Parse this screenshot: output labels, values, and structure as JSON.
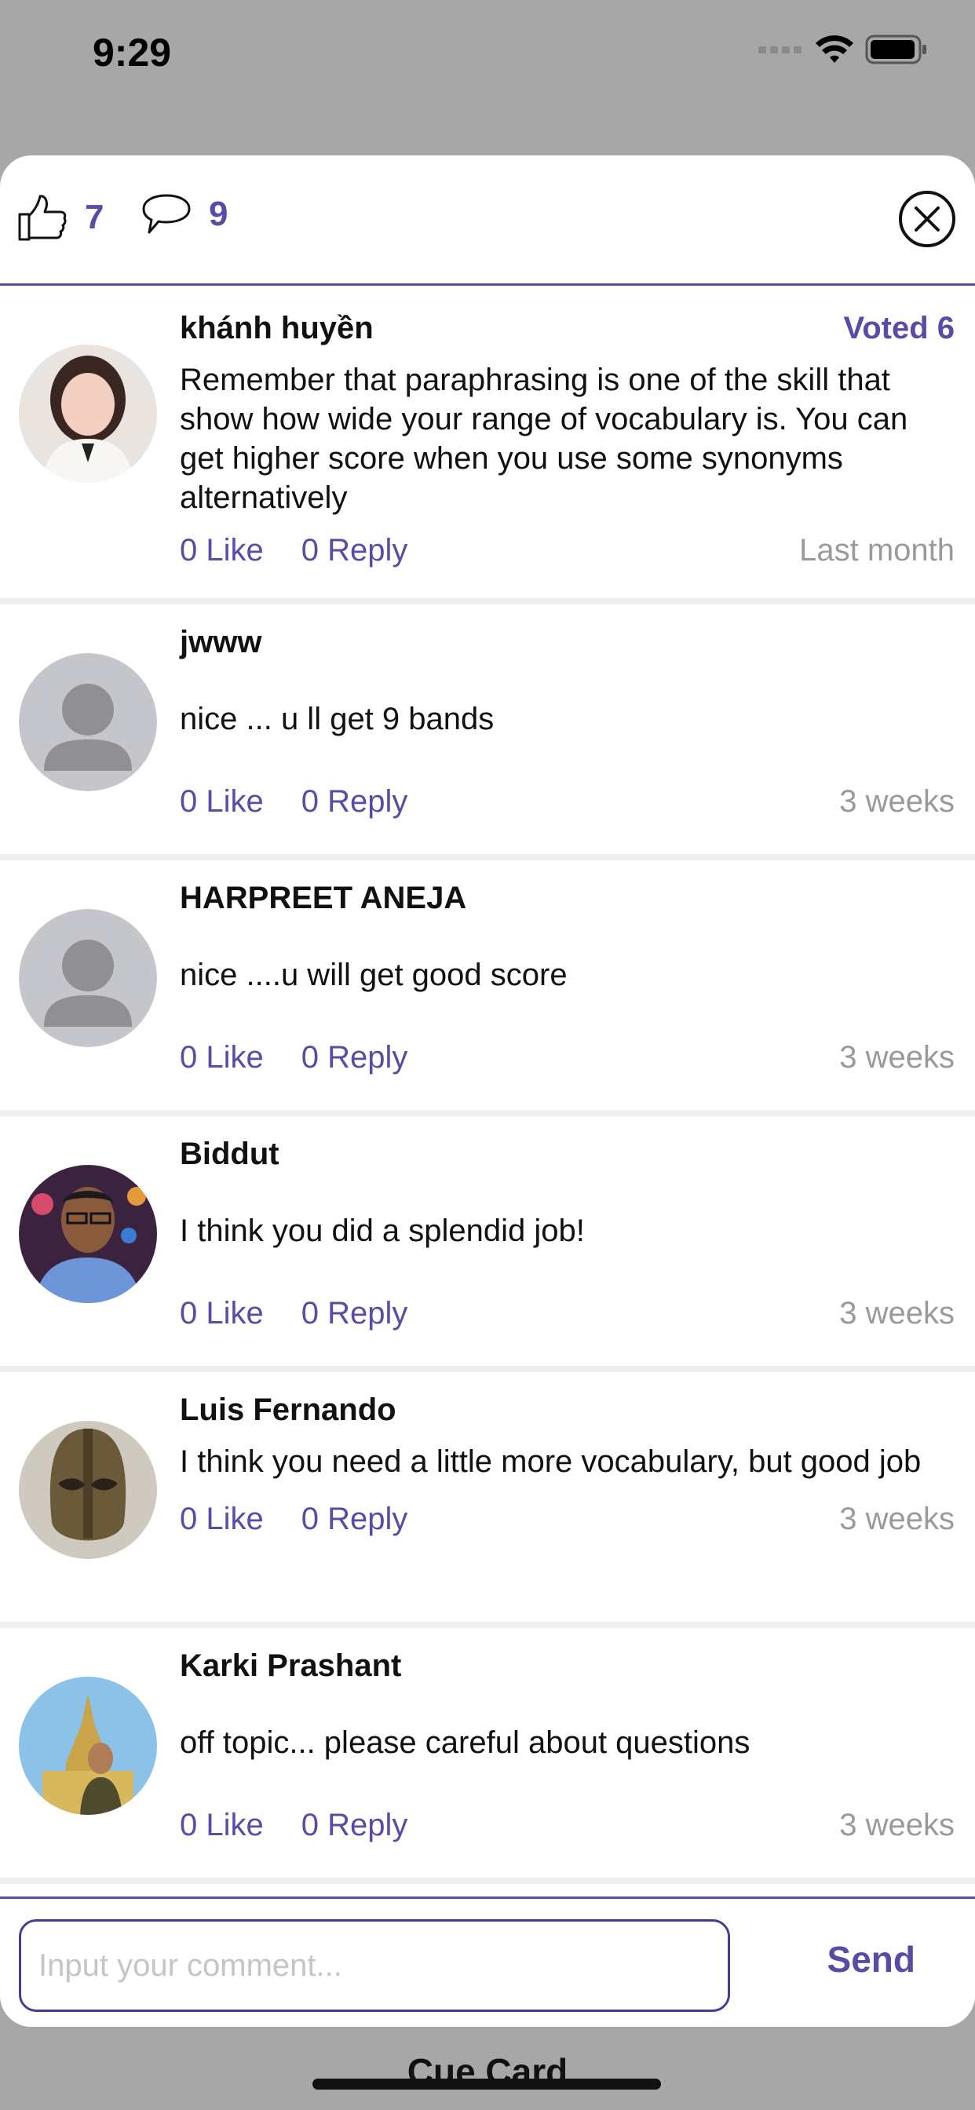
{
  "status_bar": {
    "time": "9:29"
  },
  "header": {
    "likes_count": "7",
    "comments_count": "9"
  },
  "comments": [
    {
      "author": "khánh huyền",
      "voted": "Voted 6",
      "text": "Remember that paraphrasing is one of the skill that show how wide your range of vocabulary is. You can get higher score when you use some synonyms alternatively",
      "like_label": "0 Like",
      "reply_label": "0 Reply",
      "time": "Last month",
      "avatar": "photo"
    },
    {
      "author": "jwww",
      "text": "nice ... u ll get 9 bands",
      "like_label": "0 Like",
      "reply_label": "0 Reply",
      "time": "3 weeks",
      "avatar": "default"
    },
    {
      "author": "HARPREET ANEJA",
      "text": "nice ....u will get good score",
      "like_label": "0 Like",
      "reply_label": "0 Reply",
      "time": "3 weeks",
      "avatar": "default"
    },
    {
      "author": "Biddut",
      "text": "I think you did a splendid job!",
      "like_label": "0 Like",
      "reply_label": "0 Reply",
      "time": "3 weeks",
      "avatar": "photo"
    },
    {
      "author": "Luis Fernando",
      "text": "I think you need a little more vocabulary, but good job",
      "like_label": "0 Like",
      "reply_label": "0 Reply",
      "time": "3 weeks",
      "avatar": "photo"
    },
    {
      "author": "Karki Prashant",
      "text": "off topic... please careful about questions",
      "like_label": "0 Like",
      "reply_label": "0 Reply",
      "time": "3 weeks",
      "avatar": "photo"
    }
  ],
  "footer": {
    "input_placeholder": "Input your comment...",
    "send_label": "Send"
  },
  "background": {
    "title": "Cue Card"
  },
  "colors": {
    "accent": "#5b4aa6",
    "muted": "#9a9a9a",
    "overlay": "#a7a7a7"
  }
}
